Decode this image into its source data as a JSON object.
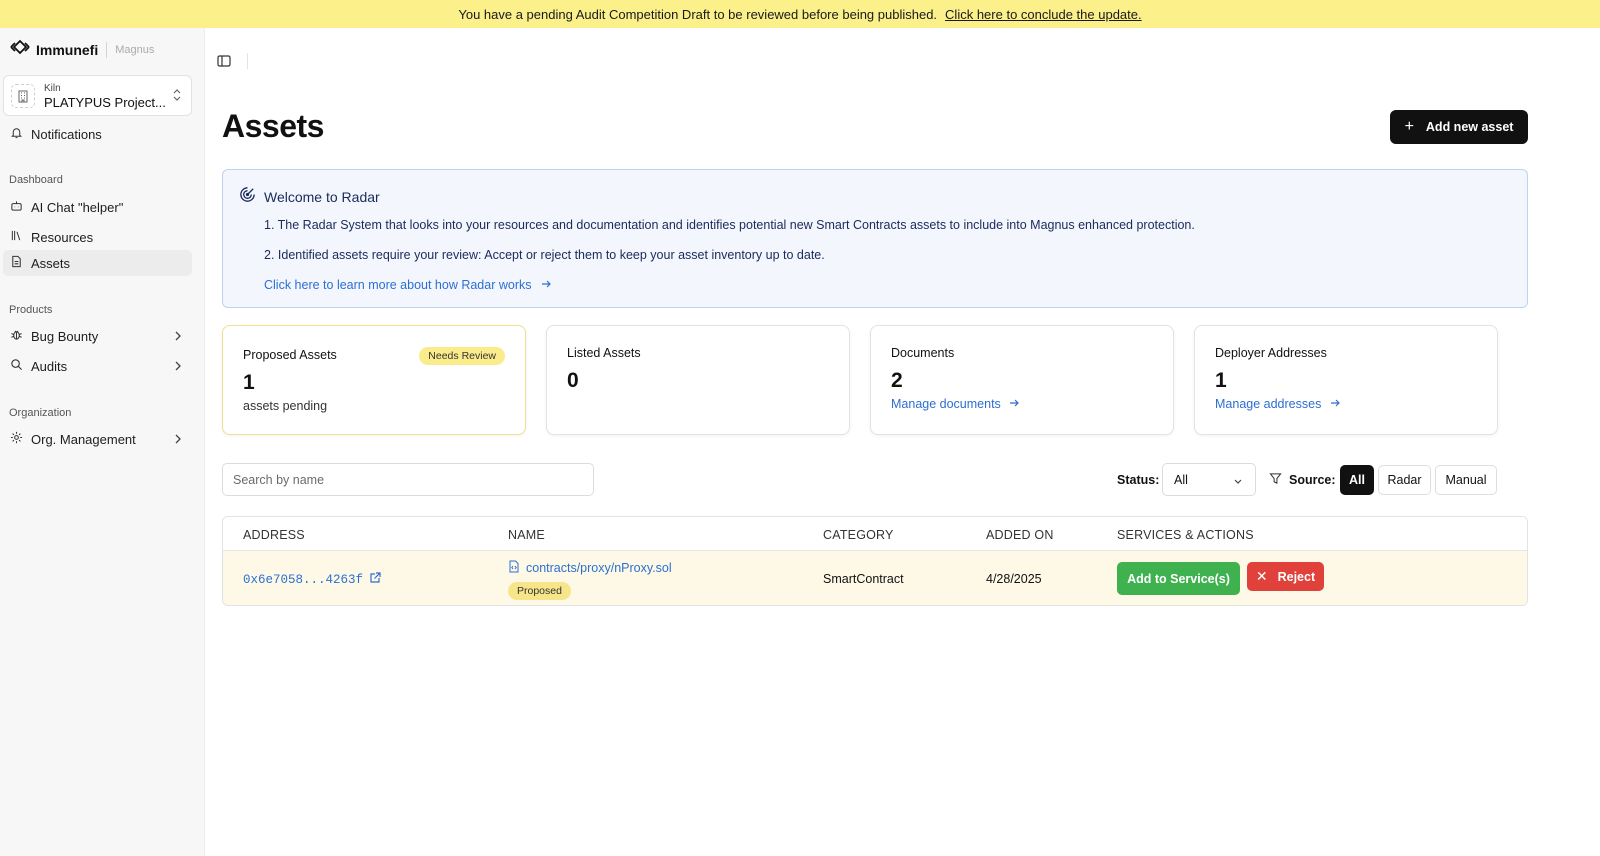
{
  "banner": {
    "message": "You have a pending Audit Competition Draft to be reviewed before being published.",
    "link": "Click here to conclude the update."
  },
  "brand": {
    "name": "Immunefi",
    "product": "Magnus"
  },
  "project": {
    "org": "Kiln",
    "name": "PLATYPUS Project..."
  },
  "sidebar": {
    "notifications": "Notifications",
    "dashboard_label": "Dashboard",
    "dashboard_items": [
      "AI Chat \"helper\"",
      "Resources",
      "Assets"
    ],
    "products_label": "Products",
    "products_items": [
      "Bug Bounty",
      "Audits"
    ],
    "organization_label": "Organization",
    "organization_items": [
      "Org. Management"
    ]
  },
  "page": {
    "title": "Assets",
    "add_button": "Add new asset"
  },
  "welcome": {
    "title": "Welcome to Radar",
    "line1": "1. The Radar System that looks into your resources and documentation and identifies potential new Smart Contracts assets to include into Magnus enhanced protection.",
    "line2": "2. Identified assets require your review: Accept or reject them to keep your asset inventory up to date.",
    "learn_more": "Click here to learn more about how Radar works"
  },
  "cards": [
    {
      "title": "Proposed Assets",
      "badge": "Needs Review",
      "value": "1",
      "sub": "assets pending"
    },
    {
      "title": "Listed Assets",
      "value": "0"
    },
    {
      "title": "Documents",
      "value": "2",
      "link": "Manage documents"
    },
    {
      "title": "Deployer Addresses",
      "value": "1",
      "link": "Manage addresses"
    }
  ],
  "filters": {
    "search_placeholder": "Search by name",
    "status_label": "Status:",
    "status_value": "All",
    "source_label": "Source:",
    "source_options": [
      "All",
      "Radar",
      "Manual"
    ],
    "source_selected": "All"
  },
  "table": {
    "columns": [
      "ADDRESS",
      "NAME",
      "CATEGORY",
      "ADDED ON",
      "SERVICES & ACTIONS"
    ],
    "rows": [
      {
        "address": "0x6e7058...4263f",
        "name": "contracts/proxy/nProxy.sol",
        "status": "Proposed",
        "category": "SmartContract",
        "added_on": "4/28/2025",
        "add_action": "Add to Service(s)",
        "reject_action": "Reject"
      }
    ]
  },
  "icons": {
    "logo": "immunefi-logo-icon",
    "project": "building-icon",
    "notifications": "bell-icon",
    "ai_chat": "bot-icon",
    "resources": "library-icon",
    "assets": "file-icon",
    "bug_bounty": "bug-icon",
    "audits": "search-icon",
    "org": "gear-icon",
    "radar": "radar-icon",
    "filter": "filter-icon"
  },
  "colors": {
    "banner": "#fbf08a",
    "primary_button": "#111111",
    "link": "#2d6fd0",
    "accept": "#3fb14e",
    "reject": "#e0413a",
    "badge": "#faec8a",
    "row_highlight": "#fdf9e6"
  }
}
